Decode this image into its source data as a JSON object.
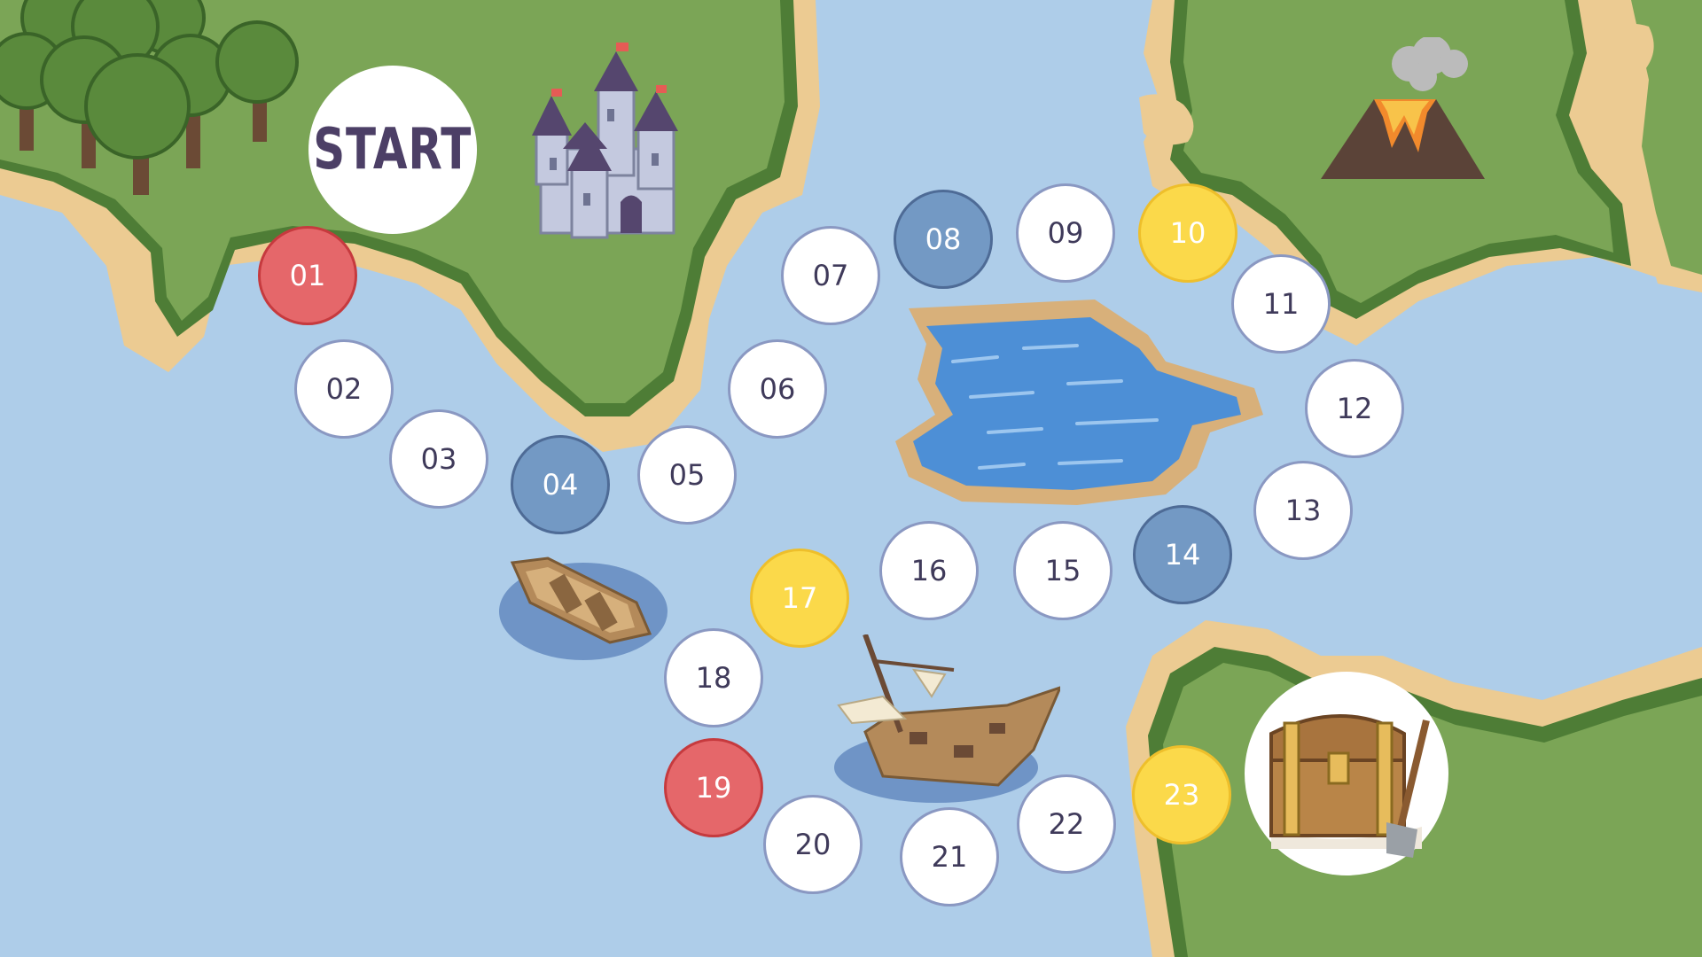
{
  "board": {
    "start_label": "START",
    "spaces": [
      {
        "label": "01",
        "color": "red"
      },
      {
        "label": "02",
        "color": "white"
      },
      {
        "label": "03",
        "color": "white"
      },
      {
        "label": "04",
        "color": "blue"
      },
      {
        "label": "05",
        "color": "white"
      },
      {
        "label": "06",
        "color": "white"
      },
      {
        "label": "07",
        "color": "white"
      },
      {
        "label": "08",
        "color": "blue"
      },
      {
        "label": "09",
        "color": "white"
      },
      {
        "label": "10",
        "color": "yellow"
      },
      {
        "label": "11",
        "color": "white"
      },
      {
        "label": "12",
        "color": "white"
      },
      {
        "label": "13",
        "color": "white"
      },
      {
        "label": "14",
        "color": "blue"
      },
      {
        "label": "15",
        "color": "white"
      },
      {
        "label": "16",
        "color": "white"
      },
      {
        "label": "17",
        "color": "yellow"
      },
      {
        "label": "18",
        "color": "white"
      },
      {
        "label": "19",
        "color": "red"
      },
      {
        "label": "20",
        "color": "white"
      },
      {
        "label": "21",
        "color": "white"
      },
      {
        "label": "22",
        "color": "white"
      },
      {
        "label": "23",
        "color": "yellow"
      }
    ]
  },
  "colors": {
    "sea": "#aecde9",
    "land": "#7ba556",
    "land_edge": "#4e7d36",
    "sand": "#eccb92",
    "red_space": "#e5676a",
    "blue_space": "#7399c4",
    "yellow_space": "#fbd94a",
    "text": "#3f3a5a"
  },
  "icons": [
    "forest-icon",
    "castle-icon",
    "volcano-icon",
    "lake-icon",
    "rowboat-icon",
    "shipwreck-icon",
    "treasure-chest-icon"
  ]
}
